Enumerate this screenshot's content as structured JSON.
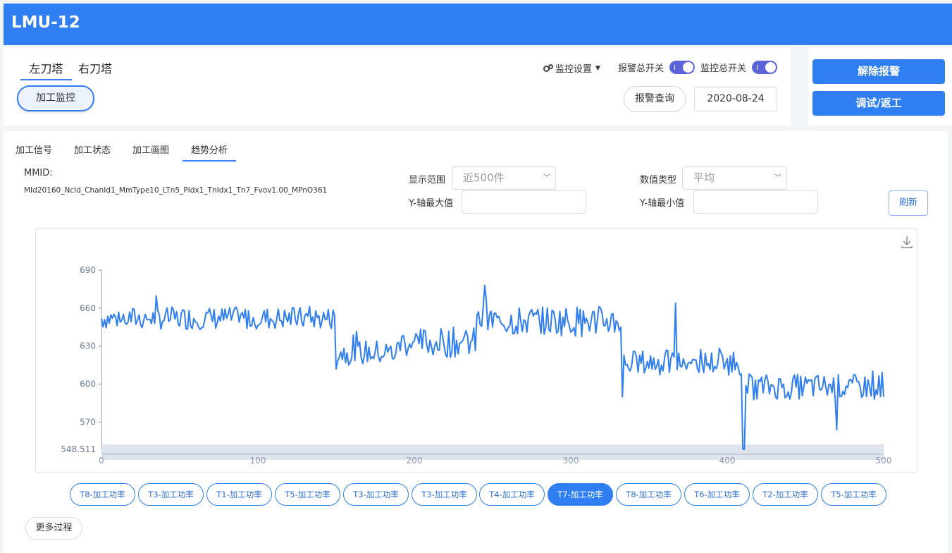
{
  "header": {
    "title": "LMU-12"
  },
  "turret_tabs": [
    {
      "label": "左刀塔",
      "active": true
    },
    {
      "label": "右刀塔",
      "active": false
    }
  ],
  "monitor_button": "加工监控",
  "settings": {
    "label": "监控设置",
    "icon": "gear-icon"
  },
  "switches": {
    "alarm": {
      "label": "报警总开关",
      "on": true
    },
    "monitor": {
      "label": "监控总开关",
      "on": true
    }
  },
  "alarm_query": "报警查询",
  "date": "2020-08-24",
  "actions": {
    "clear_alarm": "解除报警",
    "debug_rework": "调试/返工"
  },
  "sub_tabs": [
    {
      "label": "加工信号",
      "active": false
    },
    {
      "label": "加工状态",
      "active": false
    },
    {
      "label": "加工画图",
      "active": false
    },
    {
      "label": "趋势分析",
      "active": true
    }
  ],
  "mmid": {
    "label": "MMID:",
    "value": "MId20160_NcId_ChanId1_MmType10_LTn5_PIdx1_TnIdx1_Tn7_Fvov1.00_MPnO361"
  },
  "filters": {
    "range_label": "显示范围",
    "range_value": "近500件",
    "value_type_label": "数值类型",
    "value_type_value": "平均",
    "ymax_label": "Y-轴最大值",
    "ymax_value": "",
    "ymin_label": "Y-轴最小值",
    "ymin_value": ""
  },
  "refresh": "刷新",
  "download_icon": "download-icon",
  "series_buttons": [
    {
      "label": "T8-加工功率",
      "active": false
    },
    {
      "label": "T3-加工功率",
      "active": false
    },
    {
      "label": "T1-加工功率",
      "active": false
    },
    {
      "label": "T5-加工功率",
      "active": false
    },
    {
      "label": "T3-加工功率",
      "active": false
    },
    {
      "label": "T3-加工功率",
      "active": false
    },
    {
      "label": "T4-加工功率",
      "active": false
    },
    {
      "label": "T7-加工功率",
      "active": true
    },
    {
      "label": "T8-加工功率",
      "active": false
    },
    {
      "label": "T6-加工功率",
      "active": false
    },
    {
      "label": "T2-加工功率",
      "active": false
    },
    {
      "label": "T5-加工功率",
      "active": false
    }
  ],
  "more": "更多过程",
  "colors": {
    "primary": "#2f7ef2",
    "line": "#2f7ef2",
    "toggle": "#5a63d8"
  },
  "chart_data": {
    "type": "line",
    "ylim": [
      548.511,
      690
    ],
    "xlim": [
      0,
      500
    ],
    "yticks": [
      690,
      660,
      630,
      600,
      570
    ],
    "ymin_label": "548.511",
    "xticks": [
      0,
      100,
      200,
      300,
      400,
      500
    ],
    "segments": [
      {
        "x": [
          0,
          150
        ],
        "base": 652,
        "amp": 9
      },
      {
        "x": [
          150,
          190
        ],
        "base": 625,
        "amp": 10
      },
      {
        "x": [
          190,
          240
        ],
        "base": 633,
        "amp": 12
      },
      {
        "x": [
          240,
          333
        ],
        "base": 650,
        "amp": 12
      },
      {
        "x": [
          333,
          412
        ],
        "base": 617,
        "amp": 10
      },
      {
        "x": [
          412,
          500
        ],
        "base": 598,
        "amp": 10
      }
    ],
    "series": [
      {
        "values": []
      }
    ]
  }
}
